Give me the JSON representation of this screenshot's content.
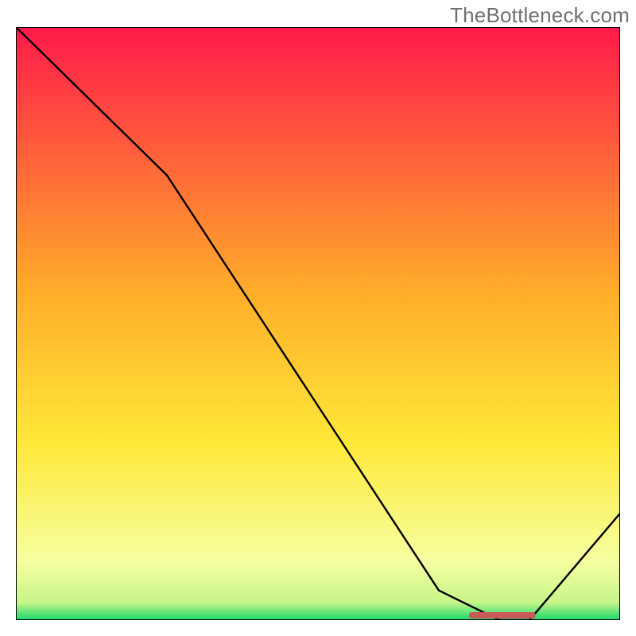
{
  "watermark": "TheBottleneck.com",
  "colors": {
    "line": "#000000",
    "marker": "#c85a5a",
    "gradient_top": "#ff1a4a",
    "gradient_mid": "#ffd233",
    "gradient_low": "#f8ffa8",
    "gradient_bottom": "#18d86b",
    "frame": "#000000"
  },
  "chart_data": {
    "type": "line",
    "title": "",
    "xlabel": "",
    "ylabel": "",
    "xlim": [
      0,
      100
    ],
    "ylim": [
      0,
      100
    ],
    "series": [
      {
        "name": "bottleneck-curve",
        "x": [
          0,
          25,
          70,
          80,
          85,
          100
        ],
        "y": [
          100,
          75,
          5,
          0,
          0,
          18
        ]
      }
    ],
    "marker": {
      "name": "optimal-range",
      "x0": 75,
      "x1": 86,
      "y": 0.8
    },
    "gradient_stops": [
      {
        "offset": 0.0,
        "color": "#ff1a4a"
      },
      {
        "offset": 0.45,
        "color": "#ffae2a"
      },
      {
        "offset": 0.7,
        "color": "#ffe838"
      },
      {
        "offset": 0.9,
        "color": "#f6ffa0"
      },
      {
        "offset": 0.97,
        "color": "#c8f58a"
      },
      {
        "offset": 1.0,
        "color": "#18d86b"
      }
    ]
  }
}
